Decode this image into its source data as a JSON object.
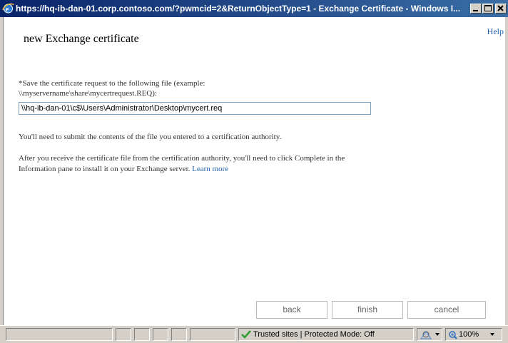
{
  "window": {
    "title": "https://hq-ib-dan-01.corp.contoso.com/?pwmcid=2&ReturnObjectType=1 - Exchange Certificate - Windows I..."
  },
  "page": {
    "title": "new Exchange certificate",
    "help_label": "Help",
    "instruction": "*Save the certificate request to the following file (example: \\\\myservername\\share\\mycertrequest.REQ):",
    "file_path": "\\\\hq-ib-dan-01\\c$\\Users\\Administrator\\Desktop\\mycert.req",
    "para1": "You'll need to submit the contents of the file you entered to a certification authority.",
    "para2": "After you receive the certificate file from the certification authority, you'll need to click Complete in the Information pane to install it on your Exchange server.",
    "learn_more": "Learn more"
  },
  "buttons": {
    "back": "back",
    "finish": "finish",
    "cancel": "cancel"
  },
  "statusbar": {
    "zone": "Trusted sites | Protected Mode: Off",
    "zoom": "100%"
  },
  "colors": {
    "titlebar_start": "#0a246a",
    "titlebar_end": "#3a6ea5",
    "link": "#1f5fa8"
  }
}
